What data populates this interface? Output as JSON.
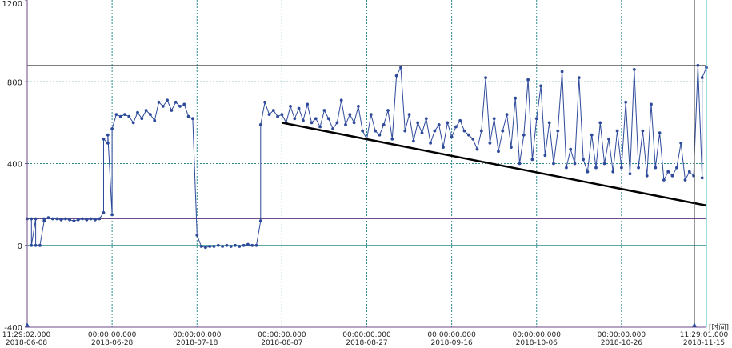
{
  "chart_data": {
    "type": "line",
    "title": "",
    "xlabel": "",
    "ylabel": "",
    "x_unit_label": "[时间]",
    "xlim": [
      "2018-06-08",
      "2018-11-15"
    ],
    "ylim": [
      -400,
      1200
    ],
    "y_ticks": [
      {
        "value": 1200,
        "label": "1200"
      },
      {
        "value": 800,
        "label": "800"
      },
      {
        "value": 400,
        "label": "400"
      },
      {
        "value": 0,
        "label": "0"
      },
      {
        "value": -400,
        "label": "-400"
      }
    ],
    "x_ticks": [
      {
        "date": "2018-06-08",
        "time": "11:29:02.000",
        "label": "2018-06-08"
      },
      {
        "date": "2018-06-28",
        "time": "00:00:00.000",
        "label": "2018-06-28"
      },
      {
        "date": "2018-07-18",
        "time": "00:00:00.000",
        "label": "2018-07-18"
      },
      {
        "date": "2018-08-07",
        "time": "00:00:00.000",
        "label": "2018-08-07"
      },
      {
        "date": "2018-08-27",
        "time": "00:00:00.000",
        "label": "2018-08-27"
      },
      {
        "date": "2018-09-16",
        "time": "00:00:00.000",
        "label": "2018-09-16"
      },
      {
        "date": "2018-10-06",
        "time": "00:00:00.000",
        "label": "2018-10-06"
      },
      {
        "date": "2018-10-26",
        "time": "00:00:00.000",
        "label": "2018-10-26"
      },
      {
        "date": "2018-11-15",
        "time": "11:29:01.000",
        "label": "2018-11-15"
      }
    ],
    "grid": true,
    "reference_lines": {
      "upper": 880,
      "lower": 130
    },
    "trend_line": {
      "start": [
        "2018-08-07",
        600
      ],
      "end": [
        "2018-11-15",
        195
      ]
    },
    "colors": {
      "series": "#2e4a9b",
      "grid": "#2a8a8a",
      "reference": "#6f4a8a",
      "upper_reference": "#555555",
      "trend": "#000000",
      "frame": "#40b8c0"
    },
    "series": [
      {
        "points": [
          [
            "2018-06-08",
            130
          ],
          [
            "2018-06-09",
            130
          ],
          [
            "2018-06-09",
            0
          ],
          [
            "2018-06-10",
            130
          ],
          [
            "2018-06-10",
            0
          ],
          [
            "2018-06-11",
            0
          ],
          [
            "2018-06-11",
            0
          ],
          [
            "2018-06-12",
            120
          ],
          [
            "2018-06-12",
            130
          ],
          [
            "2018-06-13",
            135
          ],
          [
            "2018-06-14",
            130
          ],
          [
            "2018-06-15",
            130
          ],
          [
            "2018-06-16",
            125
          ],
          [
            "2018-06-17",
            130
          ],
          [
            "2018-06-18",
            125
          ],
          [
            "2018-06-19",
            120
          ],
          [
            "2018-06-20",
            125
          ],
          [
            "2018-06-21",
            130
          ],
          [
            "2018-06-22",
            125
          ],
          [
            "2018-06-23",
            130
          ],
          [
            "2018-06-24",
            125
          ],
          [
            "2018-06-25",
            130
          ],
          [
            "2018-06-26",
            160
          ],
          [
            "2018-06-26",
            520
          ],
          [
            "2018-06-27",
            500
          ],
          [
            "2018-06-27",
            540
          ],
          [
            "2018-06-28",
            150
          ],
          [
            "2018-06-28",
            570
          ],
          [
            "2018-06-29",
            640
          ],
          [
            "2018-06-30",
            630
          ],
          [
            "2018-07-01",
            640
          ],
          [
            "2018-07-02",
            630
          ],
          [
            "2018-07-03",
            600
          ],
          [
            "2018-07-04",
            650
          ],
          [
            "2018-07-05",
            620
          ],
          [
            "2018-07-06",
            660
          ],
          [
            "2018-07-07",
            640
          ],
          [
            "2018-07-08",
            610
          ],
          [
            "2018-07-09",
            700
          ],
          [
            "2018-07-10",
            680
          ],
          [
            "2018-07-11",
            710
          ],
          [
            "2018-07-12",
            660
          ],
          [
            "2018-07-13",
            700
          ],
          [
            "2018-07-14",
            680
          ],
          [
            "2018-07-15",
            690
          ],
          [
            "2018-07-16",
            630
          ],
          [
            "2018-07-17",
            620
          ],
          [
            "2018-07-18",
            50
          ],
          [
            "2018-07-19",
            -5
          ],
          [
            "2018-07-20",
            -10
          ],
          [
            "2018-07-21",
            -5
          ],
          [
            "2018-07-22",
            -5
          ],
          [
            "2018-07-23",
            0
          ],
          [
            "2018-07-24",
            -5
          ],
          [
            "2018-07-25",
            0
          ],
          [
            "2018-07-26",
            -5
          ],
          [
            "2018-07-27",
            0
          ],
          [
            "2018-07-28",
            -5
          ],
          [
            "2018-07-29",
            0
          ],
          [
            "2018-07-30",
            5
          ],
          [
            "2018-07-31",
            0
          ],
          [
            "2018-08-01",
            0
          ],
          [
            "2018-08-02",
            120
          ],
          [
            "2018-08-02",
            590
          ],
          [
            "2018-08-03",
            700
          ],
          [
            "2018-08-04",
            640
          ],
          [
            "2018-08-05",
            660
          ],
          [
            "2018-08-06",
            630
          ],
          [
            "2018-08-07",
            640
          ],
          [
            "2018-08-08",
            600
          ],
          [
            "2018-08-09",
            680
          ],
          [
            "2018-08-10",
            620
          ],
          [
            "2018-08-11",
            670
          ],
          [
            "2018-08-12",
            610
          ],
          [
            "2018-08-13",
            690
          ],
          [
            "2018-08-14",
            600
          ],
          [
            "2018-08-15",
            620
          ],
          [
            "2018-08-16",
            580
          ],
          [
            "2018-08-17",
            660
          ],
          [
            "2018-08-18",
            620
          ],
          [
            "2018-08-19",
            570
          ],
          [
            "2018-08-20",
            600
          ],
          [
            "2018-08-21",
            710
          ],
          [
            "2018-08-22",
            590
          ],
          [
            "2018-08-23",
            640
          ],
          [
            "2018-08-24",
            600
          ],
          [
            "2018-08-25",
            680
          ],
          [
            "2018-08-26",
            560
          ],
          [
            "2018-08-27",
            520
          ],
          [
            "2018-08-28",
            640
          ],
          [
            "2018-08-29",
            560
          ],
          [
            "2018-08-30",
            540
          ],
          [
            "2018-08-31",
            590
          ],
          [
            "2018-09-01",
            660
          ],
          [
            "2018-09-02",
            520
          ],
          [
            "2018-09-03",
            830
          ],
          [
            "2018-09-04",
            870
          ],
          [
            "2018-09-05",
            560
          ],
          [
            "2018-09-06",
            640
          ],
          [
            "2018-09-07",
            510
          ],
          [
            "2018-09-08",
            600
          ],
          [
            "2018-09-09",
            550
          ],
          [
            "2018-09-10",
            620
          ],
          [
            "2018-09-11",
            500
          ],
          [
            "2018-09-12",
            560
          ],
          [
            "2018-09-13",
            590
          ],
          [
            "2018-09-14",
            480
          ],
          [
            "2018-09-15",
            600
          ],
          [
            "2018-09-16",
            530
          ],
          [
            "2018-09-17",
            580
          ],
          [
            "2018-09-18",
            610
          ],
          [
            "2018-09-19",
            560
          ],
          [
            "2018-09-20",
            540
          ],
          [
            "2018-09-21",
            520
          ],
          [
            "2018-09-22",
            470
          ],
          [
            "2018-09-23",
            560
          ],
          [
            "2018-09-24",
            820
          ],
          [
            "2018-09-25",
            500
          ],
          [
            "2018-09-26",
            620
          ],
          [
            "2018-09-27",
            460
          ],
          [
            "2018-09-28",
            560
          ],
          [
            "2018-09-29",
            640
          ],
          [
            "2018-09-30",
            480
          ],
          [
            "2018-10-01",
            720
          ],
          [
            "2018-10-02",
            400
          ],
          [
            "2018-10-03",
            540
          ],
          [
            "2018-10-04",
            810
          ],
          [
            "2018-10-05",
            420
          ],
          [
            "2018-10-06",
            620
          ],
          [
            "2018-10-07",
            780
          ],
          [
            "2018-10-08",
            440
          ],
          [
            "2018-10-09",
            600
          ],
          [
            "2018-10-10",
            400
          ],
          [
            "2018-10-11",
            560
          ],
          [
            "2018-10-12",
            850
          ],
          [
            "2018-10-13",
            380
          ],
          [
            "2018-10-14",
            470
          ],
          [
            "2018-10-15",
            400
          ],
          [
            "2018-10-16",
            820
          ],
          [
            "2018-10-17",
            420
          ],
          [
            "2018-10-18",
            360
          ],
          [
            "2018-10-19",
            540
          ],
          [
            "2018-10-20",
            380
          ],
          [
            "2018-10-21",
            600
          ],
          [
            "2018-10-22",
            400
          ],
          [
            "2018-10-23",
            520
          ],
          [
            "2018-10-24",
            360
          ],
          [
            "2018-10-25",
            560
          ],
          [
            "2018-10-26",
            380
          ],
          [
            "2018-10-27",
            700
          ],
          [
            "2018-10-28",
            350
          ],
          [
            "2018-10-29",
            860
          ],
          [
            "2018-10-30",
            380
          ],
          [
            "2018-10-31",
            560
          ],
          [
            "2018-11-01",
            340
          ],
          [
            "2018-11-02",
            690
          ],
          [
            "2018-11-03",
            380
          ],
          [
            "2018-11-04",
            550
          ],
          [
            "2018-11-05",
            320
          ],
          [
            "2018-11-06",
            360
          ],
          [
            "2018-11-07",
            340
          ],
          [
            "2018-11-08",
            380
          ],
          [
            "2018-11-09",
            500
          ],
          [
            "2018-11-10",
            320
          ],
          [
            "2018-11-11",
            360
          ],
          [
            "2018-11-12",
            340
          ],
          [
            "2018-11-13",
            880
          ],
          [
            "2018-11-14",
            330
          ],
          [
            "2018-11-14",
            820
          ],
          [
            "2018-11-15",
            870
          ]
        ]
      }
    ]
  }
}
